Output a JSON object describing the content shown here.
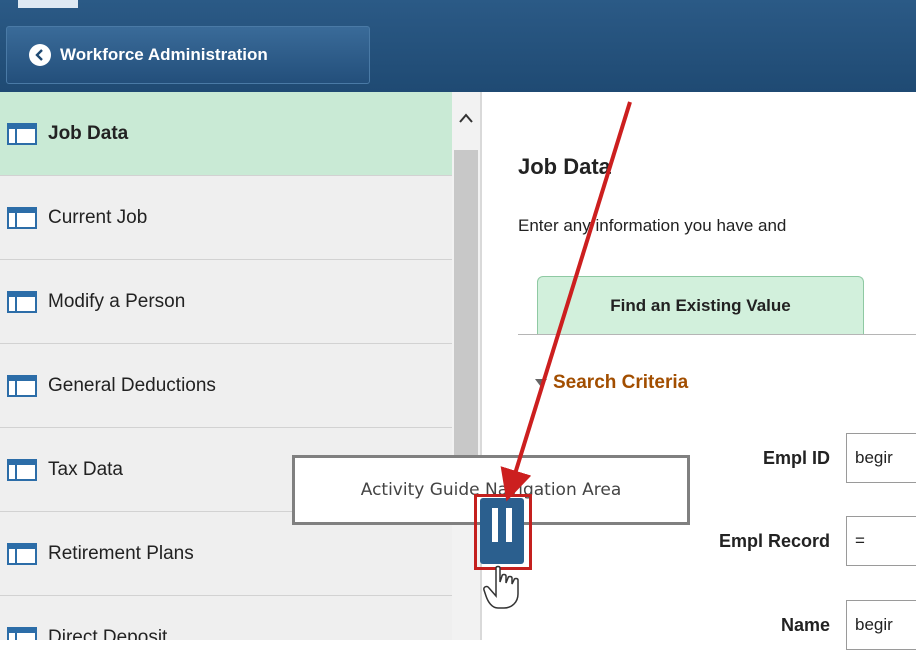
{
  "header": {
    "back_button_label": "Workforce Administration"
  },
  "nav": {
    "items": [
      {
        "label": "Job Data",
        "selected": true
      },
      {
        "label": "Current Job"
      },
      {
        "label": "Modify a Person"
      },
      {
        "label": "General Deductions"
      },
      {
        "label": "Tax Data"
      },
      {
        "label": "Retirement Plans"
      },
      {
        "label": "Direct Deposit"
      }
    ]
  },
  "main": {
    "title": "Job Data",
    "instructions": "Enter any information you have and",
    "tab_label": "Find an Existing Value",
    "section_label": "Search Criteria",
    "fields": [
      {
        "label": "Empl ID",
        "value": "begir"
      },
      {
        "label": "Empl Record",
        "value": "="
      },
      {
        "label": "Name",
        "value": "begir"
      }
    ]
  },
  "annotation": {
    "callout_text": "Activity Guide Navigation Area",
    "arrow_color": "#cc1f1f"
  },
  "colors": {
    "header_blue": "#1f4a73",
    "selected_green": "#c9ead5",
    "section_orange": "#a24e00"
  }
}
